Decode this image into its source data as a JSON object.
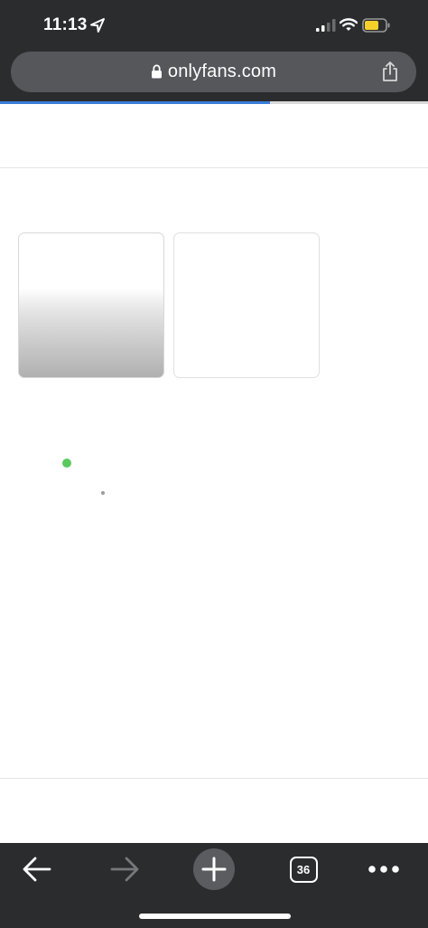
{
  "status_bar": {
    "time": "11:13",
    "icons": [
      "location-arrow-icon",
      "cellular-signal-icon",
      "wifi-icon",
      "battery-icon"
    ],
    "battery_color": "#f5d02b"
  },
  "url_bar": {
    "url": "onlyfans.com",
    "icons": [
      "lock-icon",
      "share-icon"
    ]
  },
  "page_load": {
    "progress_fraction": 0.63,
    "progress_color": "#3b7dd8"
  },
  "page": {
    "tiles": [
      "image-placeholder",
      "image-placeholder"
    ],
    "online_indicator_color": "#5bc95e"
  },
  "toolbar": {
    "tab_count": "36",
    "icons": [
      "back-arrow-icon",
      "forward-arrow-icon",
      "new-tab-plus-icon",
      "tab-count-icon",
      "more-options-icon"
    ]
  },
  "colors": {
    "chrome_background": "#2b2c2e",
    "url_bar_background": "#55575b"
  }
}
